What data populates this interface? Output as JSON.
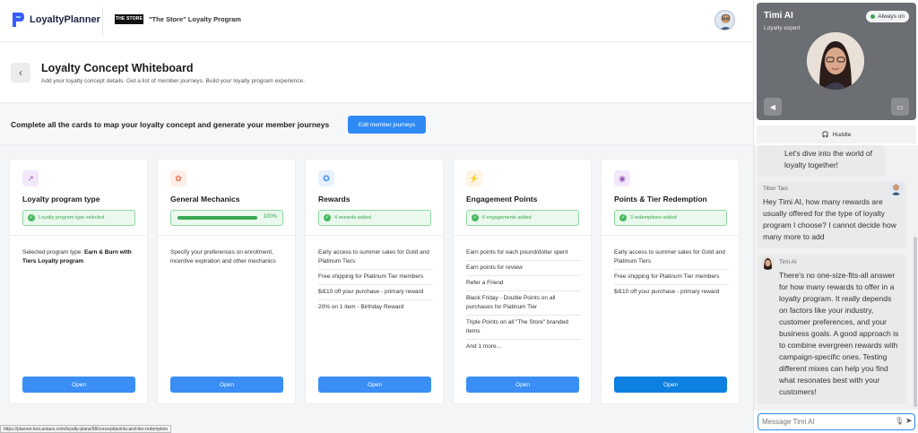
{
  "header": {
    "brand": "LoyaltyPlanner",
    "store_logo_text": "THE STORE",
    "program_name": "\"The Store\" Loyalty Program"
  },
  "page": {
    "title": "Loyalty Concept Whiteboard",
    "subtitle": "Add your loyalty concept details. Get a list of member journeys. Build your loyalty program experience.",
    "back_icon": "chevron-left-icon"
  },
  "banner": {
    "text": "Complete all the cards to map your loyalty concept and generate your member journeys",
    "button": "Edit member journeys"
  },
  "cards": [
    {
      "title": "Loyalty program type",
      "icon": "trend-arrow-icon",
      "icon_color": "#9b59b6",
      "icon_bg": "#f3e8fb",
      "status": "Loyalty program type selected",
      "body_label": "Selected program type: ",
      "body_bold": "Earn & Burn with Tiers Loyalty program",
      "button": "Open"
    },
    {
      "title": "General Mechanics",
      "icon": "gift-icon",
      "icon_color": "#e76f51",
      "icon_bg": "#fdeee7",
      "progress": 100,
      "progress_label": "100%",
      "body_text": "Specify your preferences on enrollment, incentive expiration and other mechanics",
      "button": "Open"
    },
    {
      "title": "Rewards",
      "icon": "badge-icon",
      "icon_color": "#2f8af5",
      "icon_bg": "#e8f1fe",
      "status": "4 rewards added",
      "items": [
        "Early access to summer sales for Gold and Platinum Tiers",
        "Free shipping for Platinum Tier members",
        "$/£10 off your purchase - primary reward",
        "20% on 1 item - Birthday Reward"
      ],
      "button": "Open"
    },
    {
      "title": "Engagement Points",
      "icon": "lightning-icon",
      "icon_color": "#f4a236",
      "icon_bg": "#fef3e4",
      "status": "6 engagements added",
      "items": [
        "Earn points for each pound/dollar spent",
        "Earn points for review",
        "Refer a Friend",
        "Black Friday - Double Points on all purchases for Platinum Tier",
        "Triple Points on all \"The Store\" branded items",
        "And 1 more..."
      ],
      "button": "Open"
    },
    {
      "title": "Points & Tier Redemption",
      "icon": "redeem-icon",
      "icon_color": "#9b59b6",
      "icon_bg": "#f3e8fb",
      "status": "3 redemptions added",
      "items": [
        "Early access to summer sales for Gold and Platinum Tiers",
        "Free shipping for Platinum Tier members",
        "$/£10 off your purchase - primary reward"
      ],
      "button": "Open",
      "button_color": "#0d7fe0"
    }
  ],
  "chat": {
    "ai_name": "Timi AI",
    "ai_role": "Loyalty expert",
    "always_on": "Always on",
    "huddle": "Huddle",
    "messages": [
      {
        "text": "Let's dive into the world of loyalty together!"
      },
      {
        "sender": "Tibor Tasi",
        "text": "Hey Timi AI, how many rewards are usually offered for the type of loyalty program I choose? I cannot decide how many more to add"
      },
      {
        "sender": "Timi AI",
        "text": "There's no one-size-fits-all answer for how many rewards to offer in a loyalty program. It really depends on factors like your industry, customer preferences, and your business goals. A good approach is to combine evergreen rewards with campaign-specific ones. Testing different mixes can help you find what resonates best with your customers!"
      }
    ],
    "input_placeholder": "Message Timi AI"
  },
  "status_url": "https://planner.test.antavo.com/loyalty-plans/98/concept/points-and-tier-redemption"
}
